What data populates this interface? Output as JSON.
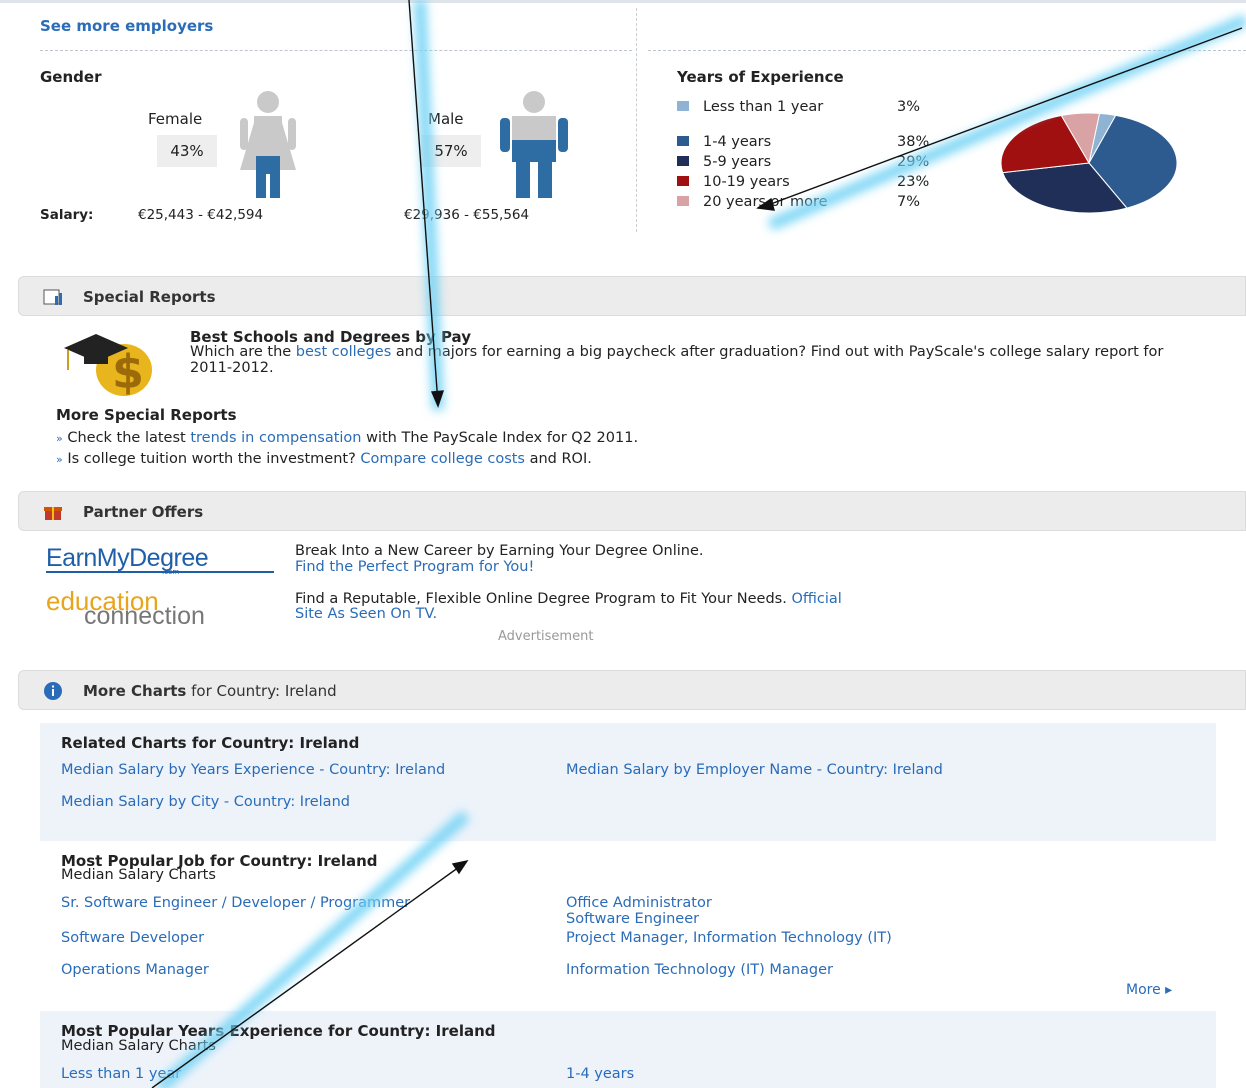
{
  "employers": {
    "see_more": "See more employers"
  },
  "gender": {
    "title": "Gender",
    "female_label": "Female",
    "female_pct": "43%",
    "male_label": "Male",
    "male_pct": "57%",
    "salary_label": "Salary:",
    "female_salary": "€25,443 - €42,594",
    "male_salary": "€29,936 - €55,564"
  },
  "experience": {
    "title": "Years of Experience",
    "items": [
      {
        "label": "Less than 1 year",
        "pct": "3%",
        "color": "#8fb3d3"
      },
      {
        "label": "1-4 years",
        "pct": "38%",
        "color": "#2e5b8f"
      },
      {
        "label": "5-9 years",
        "pct": "29%",
        "color": "#1f2f57"
      },
      {
        "label": "10-19 years",
        "pct": "23%",
        "color": "#a01010"
      },
      {
        "label": "20 years or more",
        "pct": "7%",
        "color": "#d9a3a6"
      }
    ]
  },
  "chart_data": {
    "type": "pie",
    "categories": [
      "Less than 1 year",
      "1-4 years",
      "5-9 years",
      "10-19 years",
      "20 years or more"
    ],
    "values": [
      3,
      38,
      29,
      23,
      7
    ],
    "colors": [
      "#8fb3d3",
      "#2e5b8f",
      "#1f2f57",
      "#a01010",
      "#d9a3a6"
    ],
    "title": "Years of Experience"
  },
  "special_reports": {
    "header": "Special Reports",
    "feature_title": "Best Schools and Degrees by Pay",
    "feature_text_1": "Which are the ",
    "feature_link": "best colleges",
    "feature_text_2": " and majors for earning a big paycheck after graduation? Find out with PayScale's college salary report for 2011-2012.",
    "more_title": "More Special Reports",
    "bullet1_pre": "Check the latest ",
    "bullet1_link": "trends in compensation",
    "bullet1_post": " with The PayScale Index for Q2 2011.",
    "bullet2_pre": "Is college tuition worth the investment? ",
    "bullet2_link": "Compare college costs",
    "bullet2_post": " and ROI."
  },
  "partner_offers": {
    "header": "Partner Offers",
    "offer1_logo": "EarnMyDegree",
    "offer1_logo_sub": ".com",
    "offer1_text": "Break Into a New Career by Earning Your Degree Online.",
    "offer1_link": "Find the Perfect Program for You!",
    "offer2_logo_top": "education",
    "offer2_logo_bottom": "connection",
    "offer2_text": "Find a Reputable, Flexible Online Degree Program to Fit Your Needs. ",
    "offer2_link_1": "Official",
    "offer2_link_2": "Site As Seen On TV.",
    "ad_label": "Advertisement"
  },
  "more_charts": {
    "header_bold": "More Charts",
    "header_rest": " for Country: Ireland",
    "related_title": "Related Charts for Country: Ireland",
    "related_links": [
      "Median Salary by Years Experience - Country: Ireland",
      "Median Salary by City - Country: Ireland",
      "Median Salary by Employer Name - Country: Ireland"
    ],
    "popular_job_title": "Most Popular Job for Country: Ireland",
    "popular_job_sub": "Median Salary Charts",
    "popular_jobs_left": [
      "Sr. Software Engineer / Developer / Programmer",
      "Software Developer",
      "Operations Manager"
    ],
    "popular_jobs_right": [
      "Office Administrator",
      "Software Engineer",
      "Project Manager, Information Technology (IT)",
      "Information Technology (IT) Manager"
    ],
    "more_link": "More ▸",
    "popular_exp_title": "Most Popular Years Experience for Country: Ireland",
    "popular_exp_sub": "Median Salary Charts",
    "popular_exp_left": [
      "Less than 1 year"
    ],
    "popular_exp_right": [
      "1-4 years"
    ]
  }
}
